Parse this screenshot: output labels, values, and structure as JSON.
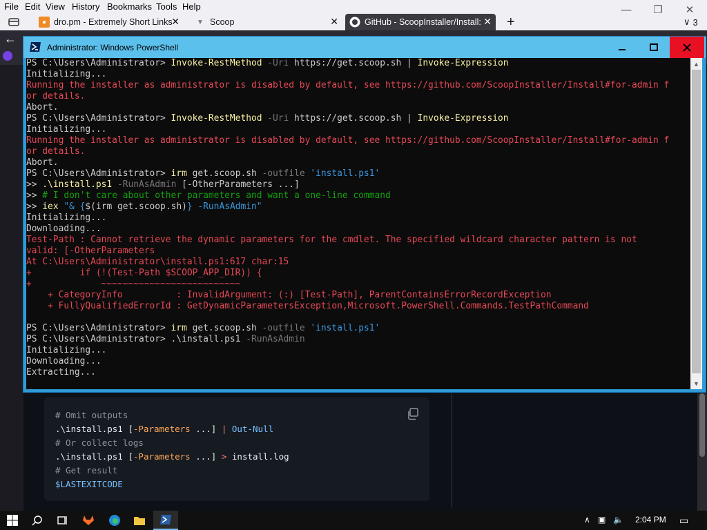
{
  "browser": {
    "menu": [
      "File",
      "Edit",
      "View",
      "History",
      "Bookmarks",
      "Tools",
      "Help"
    ],
    "tabs": [
      {
        "label": "dro.pm - Extremely Short Links",
        "icon": "dro-pm-favicon"
      },
      {
        "label": "Scoop",
        "icon": "scoop-favicon"
      },
      {
        "label": "GitHub - ScoopInstaller/Install:",
        "icon": "github-favicon",
        "active": true
      }
    ],
    "new_tab_label": "+",
    "tab_count": "3",
    "code_example": {
      "lines": [
        {
          "parts": [
            {
              "t": "# Omit outputs",
              "c": "c-com"
            }
          ]
        },
        {
          "parts": [
            {
              "t": ".\\install.ps1 [",
              "c": "c-txt"
            },
            {
              "t": "-Parameters",
              "c": "c-par"
            },
            {
              "t": " ...] ",
              "c": "c-txt"
            },
            {
              "t": "|",
              "c": "c-op"
            },
            {
              "t": " ",
              "c": "c-txt"
            },
            {
              "t": "Out-Null",
              "c": "c-cmd"
            }
          ]
        },
        {
          "parts": [
            {
              "t": "# Or collect logs",
              "c": "c-com"
            }
          ]
        },
        {
          "parts": [
            {
              "t": ".\\install.ps1 [",
              "c": "c-txt"
            },
            {
              "t": "-Parameters",
              "c": "c-par"
            },
            {
              "t": " ...] ",
              "c": "c-txt"
            },
            {
              "t": ">",
              "c": "c-op"
            },
            {
              "t": " install.log",
              "c": "c-txt"
            }
          ]
        },
        {
          "parts": [
            {
              "t": "# Get result",
              "c": "c-com"
            }
          ]
        },
        {
          "parts": [
            {
              "t": "$LASTEXITCODE",
              "c": "c-cmd"
            }
          ]
        }
      ]
    }
  },
  "powershell": {
    "title": "Administrator: Windows PowerShell",
    "lines": [
      [
        {
          "t": "PS C:\\Users\\Administrator> ",
          "c": "t-plain"
        },
        {
          "t": "Invoke-RestMethod",
          "c": "t-cmd"
        },
        {
          "t": " -Uri",
          "c": "t-param"
        },
        {
          "t": " https://get.scoop.sh | ",
          "c": "t-plain"
        },
        {
          "t": "Invoke-Expression",
          "c": "t-cmd"
        }
      ],
      [
        {
          "t": "Initializing...",
          "c": "t-plain"
        }
      ],
      [
        {
          "t": "Running the installer as administrator is disabled by default, see https://github.com/ScoopInstaller/Install#for-admin f",
          "c": "t-err"
        }
      ],
      [
        {
          "t": "or details.",
          "c": "t-err"
        }
      ],
      [
        {
          "t": "Abort.",
          "c": "t-plain"
        }
      ],
      [
        {
          "t": "PS C:\\Users\\Administrator> ",
          "c": "t-plain"
        },
        {
          "t": "Invoke-RestMethod",
          "c": "t-cmd"
        },
        {
          "t": " -Uri",
          "c": "t-param"
        },
        {
          "t": " https://get.scoop.sh | ",
          "c": "t-plain"
        },
        {
          "t": "Invoke-Expression",
          "c": "t-cmd"
        }
      ],
      [
        {
          "t": "Initializing...",
          "c": "t-plain"
        }
      ],
      [
        {
          "t": "Running the installer as administrator is disabled by default, see https://github.com/ScoopInstaller/Install#for-admin f",
          "c": "t-err"
        }
      ],
      [
        {
          "t": "or details.",
          "c": "t-err"
        }
      ],
      [
        {
          "t": "Abort.",
          "c": "t-plain"
        }
      ],
      [
        {
          "t": "PS C:\\Users\\Administrator> ",
          "c": "t-plain"
        },
        {
          "t": "irm",
          "c": "t-cmd"
        },
        {
          "t": " get.scoop.sh",
          "c": "t-plain"
        },
        {
          "t": " -outfile",
          "c": "t-param"
        },
        {
          "t": " 'install.ps1'",
          "c": "t-str"
        }
      ],
      [
        {
          "t": ">> ",
          "c": "t-plain"
        },
        {
          "t": ".\\install.ps1",
          "c": "t-cmd"
        },
        {
          "t": " -RunAsAdmin",
          "c": "t-param"
        },
        {
          "t": " [-OtherParameters ...]",
          "c": "t-plain"
        }
      ],
      [
        {
          "t": ">> ",
          "c": "t-plain"
        },
        {
          "t": "# I don't care about other parameters and want a one-line command",
          "c": "t-com"
        }
      ],
      [
        {
          "t": ">> ",
          "c": "t-plain"
        },
        {
          "t": "iex",
          "c": "t-cmd"
        },
        {
          "t": " \"& {",
          "c": "t-str"
        },
        {
          "t": "$(irm get.scoop.sh)",
          "c": "t-plain"
        },
        {
          "t": "} -RunAsAdmin\"",
          "c": "t-str"
        }
      ],
      [
        {
          "t": "Initializing...",
          "c": "t-plain"
        }
      ],
      [
        {
          "t": "Downloading...",
          "c": "t-plain"
        }
      ],
      [
        {
          "t": "Test-Path : Cannot retrieve the dynamic parameters for the cmdlet. The specified wildcard character pattern is not",
          "c": "t-err"
        }
      ],
      [
        {
          "t": "valid: [-OtherParameters",
          "c": "t-err"
        }
      ],
      [
        {
          "t": "At C:\\Users\\Administrator\\install.ps1:617 char:15",
          "c": "t-err"
        }
      ],
      [
        {
          "t": "+         if (!(Test-Path $SCOOP_APP_DIR)) {",
          "c": "t-err"
        }
      ],
      [
        {
          "t": "+             ~~~~~~~~~~~~~~~~~~~~~~~~~~",
          "c": "t-err"
        }
      ],
      [
        {
          "t": "    + CategoryInfo          : InvalidArgument: (:) [Test-Path], ParentContainsErrorRecordException",
          "c": "t-err"
        }
      ],
      [
        {
          "t": "    + FullyQualifiedErrorId : GetDynamicParametersException,Microsoft.PowerShell.Commands.TestPathCommand",
          "c": "t-err"
        }
      ],
      [
        {
          "t": "",
          "c": "t-plain"
        }
      ],
      [
        {
          "t": "PS C:\\Users\\Administrator> ",
          "c": "t-plain"
        },
        {
          "t": "irm",
          "c": "t-cmd"
        },
        {
          "t": " get.scoop.sh",
          "c": "t-plain"
        },
        {
          "t": " -outfile",
          "c": "t-param"
        },
        {
          "t": " 'install.ps1'",
          "c": "t-str"
        }
      ],
      [
        {
          "t": "PS C:\\Users\\Administrator> ",
          "c": "t-plain"
        },
        {
          "t": ".\\install.ps1",
          "c": "t-plain"
        },
        {
          "t": " -RunAsAdmin",
          "c": "t-param"
        }
      ],
      [
        {
          "t": "Initializing...",
          "c": "t-plain"
        }
      ],
      [
        {
          "t": "Downloading...",
          "c": "t-plain"
        }
      ],
      [
        {
          "t": "Extracting...",
          "c": "t-plain"
        }
      ]
    ]
  },
  "taskbar": {
    "items": [
      "start-icon",
      "search-icon",
      "task-view-icon",
      "gitlab-icon",
      "edge-icon",
      "file-explorer-icon",
      "powershell-icon"
    ],
    "clock": "2:04 PM"
  }
}
